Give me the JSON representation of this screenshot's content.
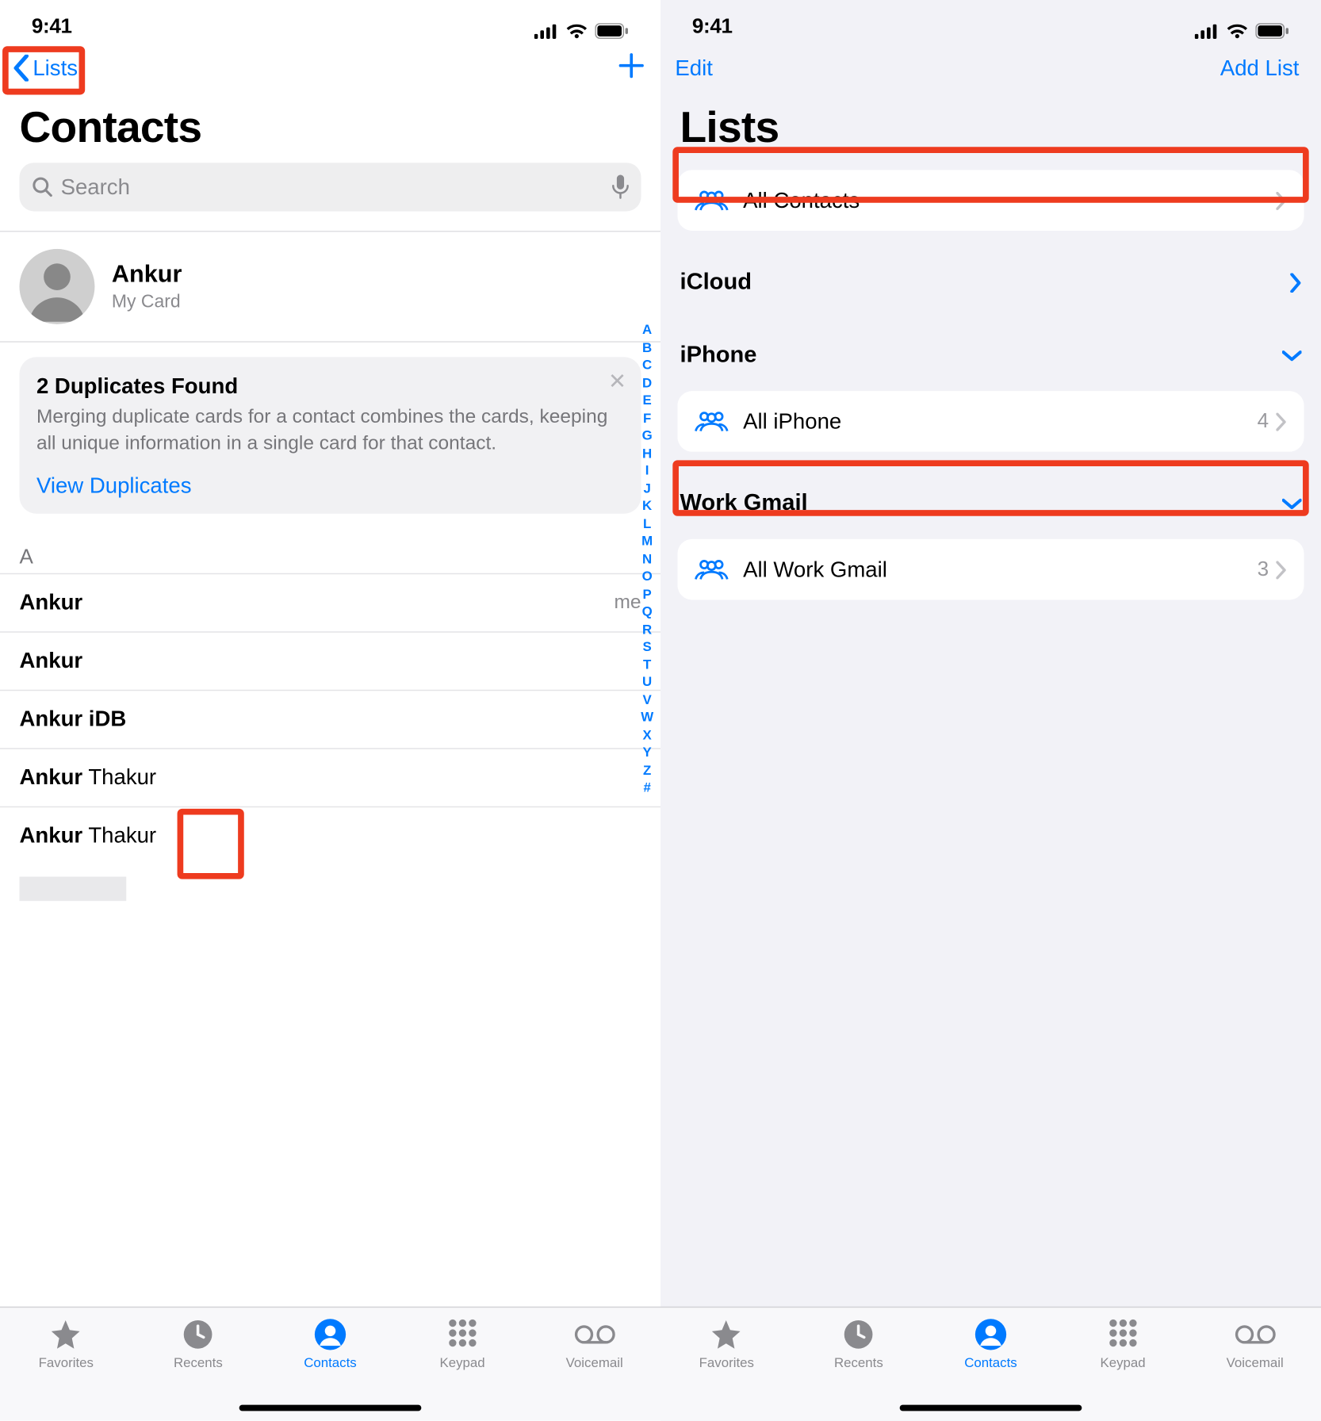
{
  "status": {
    "time": "9:41"
  },
  "left": {
    "nav": {
      "back_label": "Lists"
    },
    "title": "Contacts",
    "search": {
      "placeholder": "Search"
    },
    "mycard": {
      "name": "Ankur",
      "sub": "My Card"
    },
    "duplicates": {
      "title": "2 Duplicates Found",
      "body": "Merging duplicate cards for a contact combines the cards, keeping all unique information in a single card for that contact.",
      "link": "View Duplicates"
    },
    "section_letter": "A",
    "contacts": [
      {
        "first": "Ankur",
        "last": "",
        "me": "me"
      },
      {
        "first": "Ankur",
        "last": "",
        "me": ""
      },
      {
        "first": "Ankur iDB",
        "last": "",
        "me": ""
      },
      {
        "first": "Ankur",
        "last": "Thakur",
        "me": ""
      },
      {
        "first": "Ankur",
        "last": "Thakur",
        "me": ""
      }
    ],
    "alpha": [
      "A",
      "B",
      "C",
      "D",
      "E",
      "F",
      "G",
      "H",
      "I",
      "J",
      "K",
      "L",
      "M",
      "N",
      "O",
      "P",
      "Q",
      "R",
      "S",
      "T",
      "U",
      "V",
      "W",
      "X",
      "Y",
      "Z",
      "#"
    ]
  },
  "right": {
    "nav": {
      "edit": "Edit",
      "add": "Add List"
    },
    "title": "Lists",
    "rows": {
      "all_contacts": "All Contacts",
      "icloud_header": "iCloud",
      "iphone_header": "iPhone",
      "all_iphone": "All iPhone",
      "all_iphone_count": "4",
      "workgmail_header": "Work Gmail",
      "all_workgmail": "All Work Gmail",
      "all_workgmail_count": "3"
    }
  },
  "tabs": {
    "favorites": "Favorites",
    "recents": "Recents",
    "contacts": "Contacts",
    "keypad": "Keypad",
    "voicemail": "Voicemail"
  }
}
